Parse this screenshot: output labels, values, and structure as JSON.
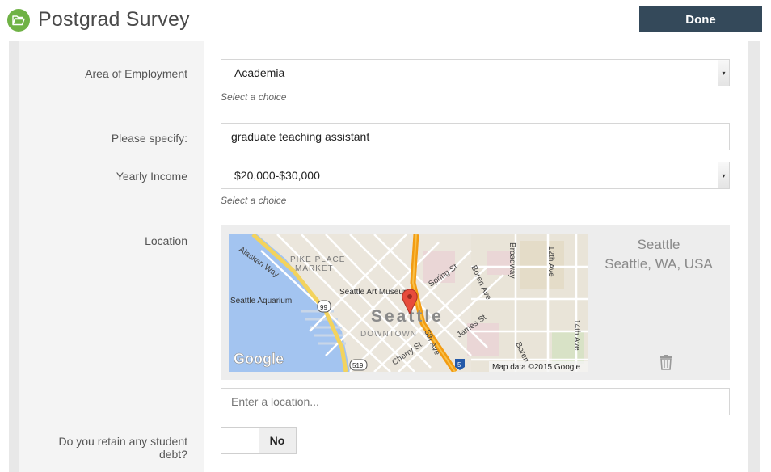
{
  "header": {
    "title": "Postgrad Survey",
    "done_label": "Done"
  },
  "fields": {
    "employment": {
      "label": "Area of Employment",
      "value": "Academia",
      "hint": "Select a choice"
    },
    "specify": {
      "label": "Please specify:",
      "value": "graduate teaching assistant"
    },
    "income": {
      "label": "Yearly Income",
      "value": "$20,000-$30,000",
      "hint": "Select a choice"
    },
    "location": {
      "label": "Location",
      "name": "Seattle",
      "address": "Seattle, WA, USA",
      "input_placeholder": "Enter a location...",
      "map": {
        "labels": {
          "alaskan": "Alaskan Way",
          "pike1": "PIKE PLACE",
          "pike2": "MARKET",
          "art": "Seattle Art Museum",
          "aquarium": "Seattle Aquarium",
          "city": "Seattle",
          "downtown": "DOWNTOWN",
          "spring": "Spring St",
          "boren1": "Boren Ave",
          "broadway": "Broadway",
          "twelfth": "12th Ave",
          "fourteenth": "14th Ave",
          "james": "James St",
          "fifth": "5th Ave",
          "cherry": "Cherry St",
          "boren2": "Boren",
          "hw99": "99",
          "hw519": "519",
          "hw5": "5",
          "google": "Google",
          "attribution": "Map data ©2015 Google"
        }
      }
    },
    "debt": {
      "label": "Do you retain any student debt?",
      "toggle_value": "No"
    }
  },
  "colors": {
    "header_button": "#34495a",
    "app_icon": "#6fb245",
    "marker": "#e74c3c"
  }
}
